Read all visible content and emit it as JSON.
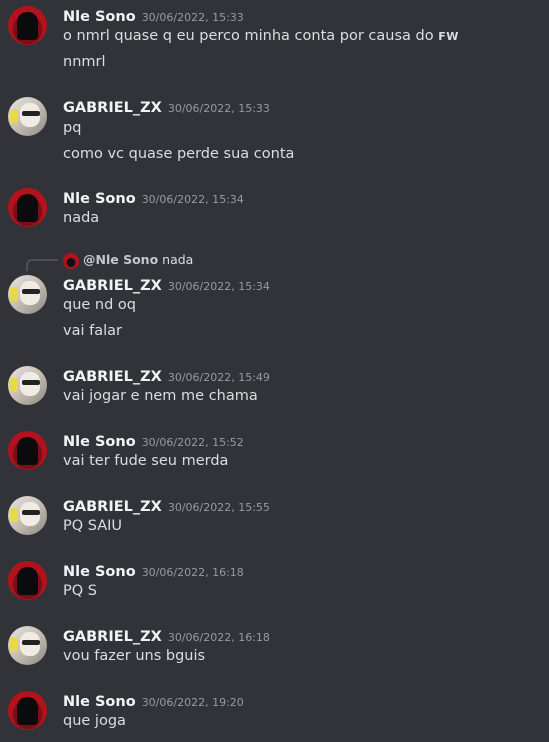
{
  "messages": [
    {
      "author": "Nle Sono",
      "timestamp": "30/06/2022, 15:33",
      "lines": [
        "o nmrl quase q eu perco minha conta por causa do",
        "nnmrl"
      ],
      "tag": "FW"
    },
    {
      "author": "GABRIEL_ZX",
      "timestamp": "30/06/2022, 15:33",
      "lines": [
        "pq",
        "como vc quase perde sua conta"
      ]
    },
    {
      "author": "Nle Sono",
      "timestamp": "30/06/2022, 15:34",
      "lines": [
        "nada"
      ]
    },
    {
      "author": "GABRIEL_ZX",
      "timestamp": "30/06/2022, 15:34",
      "lines": [
        "que nd oq",
        "vai falar"
      ],
      "reply": {
        "author": "@Nle Sono",
        "text": "nada"
      }
    },
    {
      "author": "GABRIEL_ZX",
      "timestamp": "30/06/2022, 15:49",
      "lines": [
        "vai jogar e nem me chama"
      ]
    },
    {
      "author": "Nle Sono",
      "timestamp": "30/06/2022, 15:52",
      "lines": [
        "vai ter fude seu merda"
      ]
    },
    {
      "author": "GABRIEL_ZX",
      "timestamp": "30/06/2022, 15:55",
      "lines": [
        "PQ SAIU"
      ]
    },
    {
      "author": "Nle Sono",
      "timestamp": "30/06/2022, 16:18",
      "lines": [
        "PQ S"
      ]
    },
    {
      "author": "GABRIEL_ZX",
      "timestamp": "30/06/2022, 16:18",
      "lines": [
        "vou fazer uns bguis"
      ]
    },
    {
      "author": "Nle Sono",
      "timestamp": "30/06/2022, 19:20",
      "lines": [
        "que joga"
      ]
    }
  ]
}
